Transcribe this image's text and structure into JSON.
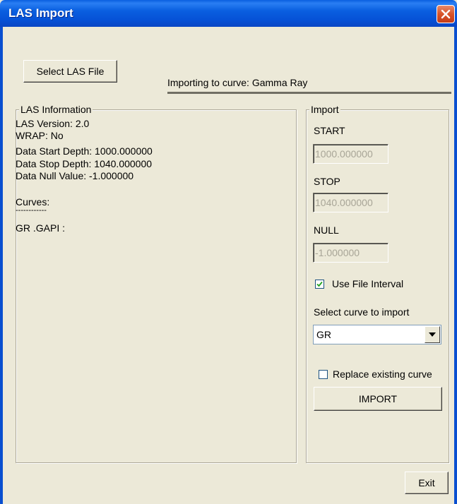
{
  "window": {
    "title": "LAS Import"
  },
  "toolbar": {
    "select_file_label": "Select LAS File"
  },
  "status": {
    "importing_to": "Importing to curve: Gamma Ray"
  },
  "las_information": {
    "group_label": "LAS Information",
    "lines": [
      "LAS Version: 2.0",
      "WRAP: No",
      "Data Start Depth: 1000.000000",
      "Data Stop Depth: 1040.000000",
      "Data Null Value: -1.000000"
    ],
    "curves_label": "Curves:",
    "curves_divider": "------------",
    "curves": [
      "GR .GAPI :"
    ]
  },
  "import_panel": {
    "group_label": "Import",
    "start_label": "START",
    "start_value": "1000.000000",
    "stop_label": "STOP",
    "stop_value": "1040.000000",
    "null_label": "NULL",
    "null_value": "-1.000000",
    "use_file_interval_label": "Use File Interval",
    "use_file_interval_checked": true,
    "select_curve_label": "Select curve to import",
    "selected_curve": "GR",
    "replace_existing_label": "Replace existing curve",
    "replace_existing_checked": false,
    "import_button_label": "IMPORT"
  },
  "footer": {
    "exit_label": "Exit"
  },
  "icons": {
    "close": "close-icon",
    "checkmark": "checkmark-icon",
    "dropdown": "chevron-down-icon"
  },
  "colors": {
    "titlebar": "#0a5fe0",
    "dialog_bg": "#ece9d8",
    "close_button": "#d8542a",
    "disabled_text": "#a8a597"
  }
}
